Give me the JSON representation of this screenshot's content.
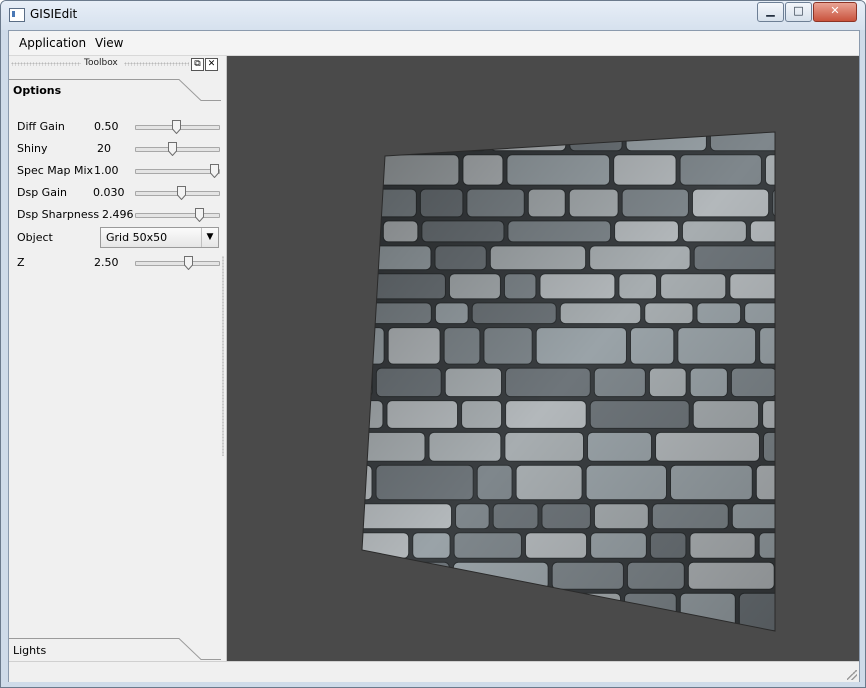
{
  "window": {
    "title": "GISIEdit"
  },
  "window_controls": {
    "minimize": "▁",
    "maximize": "□",
    "close": "✕"
  },
  "menubar": {
    "items": [
      "Application",
      "View"
    ]
  },
  "toolbox": {
    "title": "Toolbox",
    "float_button": "⧉",
    "close_button": "✕",
    "options_tab": "Options",
    "lights_tab": "Lights",
    "params": [
      {
        "label": "Diff Gain",
        "value": "0.50",
        "slider": 0.5
      },
      {
        "label": "Shiny",
        "value": "20",
        "slider": 0.45
      },
      {
        "label": "Spec Map Mix",
        "value": "1.00",
        "slider": 1.0
      },
      {
        "label": "Dsp Gain",
        "value": "0.030",
        "slider": 0.55
      },
      {
        "label": "Dsp Sharpness",
        "value": "2.496",
        "slider": 0.78
      }
    ],
    "object": {
      "label": "Object",
      "selected": "Grid 50x50"
    },
    "z": {
      "label": "Z",
      "value": "2.50",
      "slider": 0.65
    }
  },
  "viewport": {
    "background": "#4a4a4a",
    "stone_colors": [
      "#9aa3a8",
      "#7f878c",
      "#b3b8bb",
      "#6e757a",
      "#a7adb0"
    ]
  }
}
